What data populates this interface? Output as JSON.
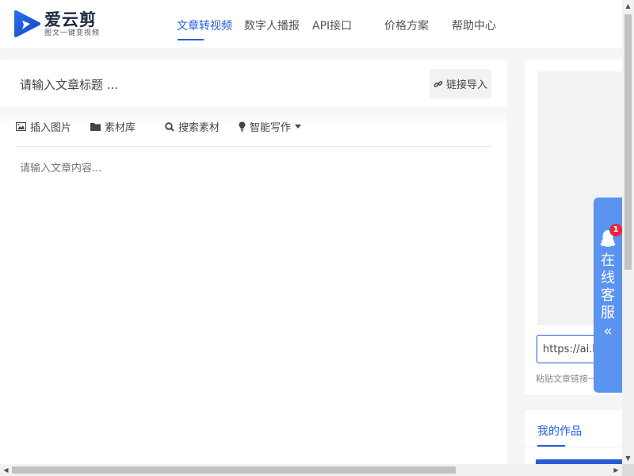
{
  "brand": {
    "name": "爱云剪",
    "tagline": "图文一键变视频",
    "accent": "#1f5fe0"
  },
  "nav": {
    "items": [
      {
        "label": "文章转视频",
        "active": true
      },
      {
        "label": "数字人播报",
        "active": false
      },
      {
        "label": "API接口",
        "active": false
      },
      {
        "label": "价格方案",
        "active": false
      },
      {
        "label": "帮助中心",
        "active": false
      }
    ]
  },
  "editor": {
    "title_placeholder": "请输入文章标题 ...",
    "link_button": "链接导入",
    "toolbar": [
      {
        "label": "插入图片",
        "icon": "image-icon"
      },
      {
        "label": "素材库",
        "icon": "folder-icon"
      },
      {
        "label": "搜索素材",
        "icon": "search-icon"
      },
      {
        "label": "智能写作",
        "icon": "lightbulb-icon"
      }
    ],
    "content_placeholder": "请输入文章内容..."
  },
  "sidebar": {
    "url_value": "https://ai.h",
    "note": "粘贴文章链接一键导入内容",
    "tab_label": "我的作品"
  },
  "service": {
    "label_chars": [
      "在",
      "线",
      "客",
      "服"
    ],
    "badge_count": "1",
    "color": "#5b93f0"
  }
}
